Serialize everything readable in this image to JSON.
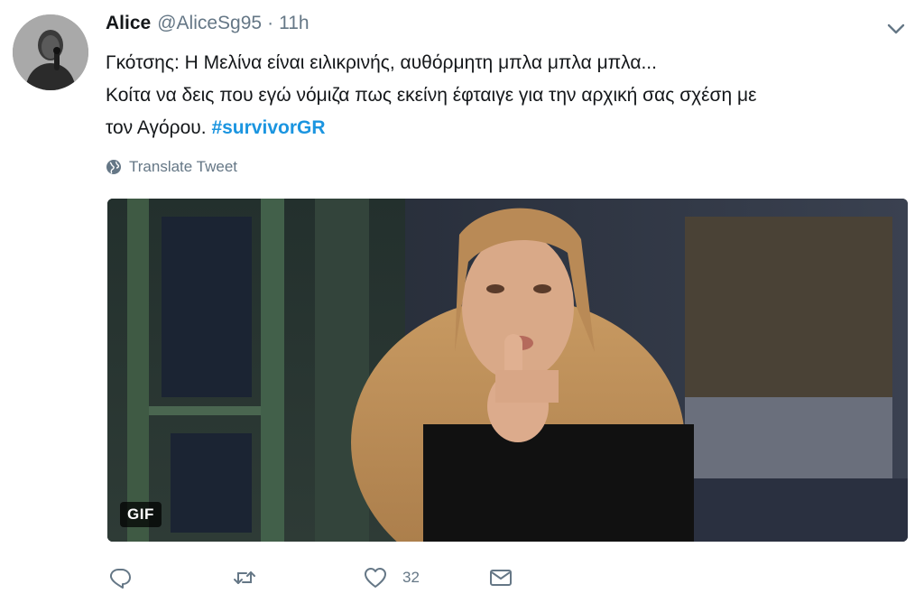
{
  "tweet": {
    "author_name": "Alice",
    "author_handle": "@AliceSg95",
    "separator": "·",
    "time": "11h",
    "text_line1": "Γκότσης: Η Μελίνα είναι ειλικρινής, αυθόρμητη μπλα μπλα μπλα...",
    "text_line2": "Κοίτα να δεις που εγώ νόμιζα πως εκείνη έφταιγε για την αρχική σας σχέση με",
    "text_line3_prefix": "τον Αγόρου. ",
    "hashtag": "#survivorGR",
    "translate_label": "Translate Tweet",
    "media_badge": "GIF",
    "like_count": "32"
  },
  "colors": {
    "text": "#14171a",
    "secondary": "#657786",
    "link": "#1b95e0",
    "background": "#ffffff"
  },
  "icons": {
    "caret": "chevron-down-icon",
    "translate": "globe-icon",
    "reply": "reply-icon",
    "retweet": "retweet-icon",
    "like": "heart-icon",
    "message": "envelope-icon"
  }
}
